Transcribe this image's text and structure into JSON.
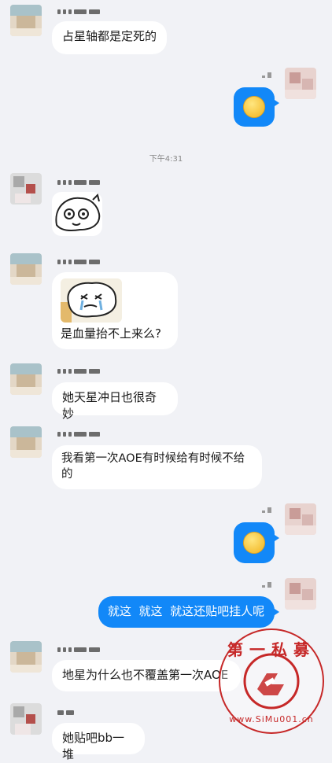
{
  "timestamp": "下午4:31",
  "messages": {
    "m1": "占星轴都是定死的",
    "m4": "是血量抬不上来么?",
    "m5": "她天星冲日也很奇妙",
    "m6": "我看第一次AOE有时候给有时候不给的",
    "m8": "就这  就这  就这还贴吧挂人呢",
    "m9": "地星为什么也不覆盖第一次AOE",
    "m10": "她贴吧bb一堆"
  },
  "watermark": {
    "line_top": "第一私募",
    "line_bottom": "www.SiMu001.cn"
  },
  "colors": {
    "background": "#f1f2f6",
    "outgoing_bubble": "#1288f8",
    "incoming_bubble": "#ffffff",
    "watermark": "#c62828"
  }
}
